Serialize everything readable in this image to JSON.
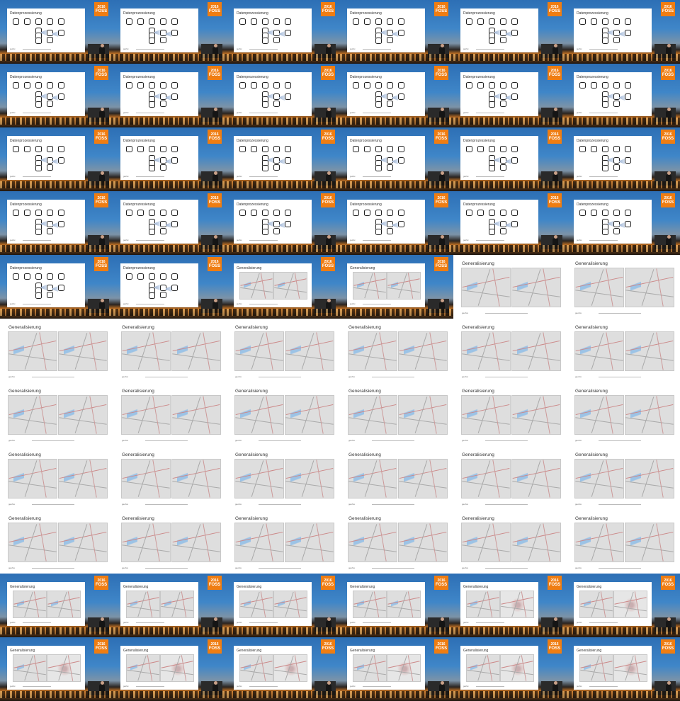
{
  "grid": {
    "columns": 6,
    "rows": 11
  },
  "logo": {
    "year": "2016",
    "name": "FOSS",
    "color": "#ef7d12"
  },
  "slide_titles": {
    "diagram": "Datenprozessierung",
    "maps": "Generalisierung"
  },
  "footer_label": "geofox",
  "cells": [
    {
      "scene": "stage",
      "content": "diagram"
    },
    {
      "scene": "stage",
      "content": "diagram"
    },
    {
      "scene": "stage",
      "content": "diagram"
    },
    {
      "scene": "stage",
      "content": "diagram"
    },
    {
      "scene": "stage",
      "content": "diagram"
    },
    {
      "scene": "stage",
      "content": "diagram"
    },
    {
      "scene": "stage",
      "content": "diagram"
    },
    {
      "scene": "stage",
      "content": "diagram"
    },
    {
      "scene": "stage",
      "content": "diagram"
    },
    {
      "scene": "stage",
      "content": "diagram"
    },
    {
      "scene": "stage",
      "content": "diagram"
    },
    {
      "scene": "stage",
      "content": "diagram"
    },
    {
      "scene": "stage",
      "content": "diagram"
    },
    {
      "scene": "stage",
      "content": "diagram"
    },
    {
      "scene": "stage",
      "content": "diagram"
    },
    {
      "scene": "stage",
      "content": "diagram"
    },
    {
      "scene": "stage",
      "content": "diagram"
    },
    {
      "scene": "stage",
      "content": "diagram"
    },
    {
      "scene": "stage",
      "content": "diagram"
    },
    {
      "scene": "stage",
      "content": "diagram"
    },
    {
      "scene": "stage",
      "content": "diagram"
    },
    {
      "scene": "stage",
      "content": "diagram"
    },
    {
      "scene": "stage",
      "content": "diagram"
    },
    {
      "scene": "stage",
      "content": "diagram"
    },
    {
      "scene": "stage",
      "content": "diagram"
    },
    {
      "scene": "stage",
      "content": "diagram"
    },
    {
      "scene": "stage",
      "content": "maps"
    },
    {
      "scene": "stage",
      "content": "maps"
    },
    {
      "scene": "clean",
      "content": "maps"
    },
    {
      "scene": "clean",
      "content": "maps"
    },
    {
      "scene": "clean",
      "content": "maps"
    },
    {
      "scene": "clean",
      "content": "maps"
    },
    {
      "scene": "clean",
      "content": "maps"
    },
    {
      "scene": "clean",
      "content": "maps"
    },
    {
      "scene": "clean",
      "content": "maps"
    },
    {
      "scene": "clean",
      "content": "maps"
    },
    {
      "scene": "clean",
      "content": "maps"
    },
    {
      "scene": "clean",
      "content": "maps"
    },
    {
      "scene": "clean",
      "content": "maps"
    },
    {
      "scene": "clean",
      "content": "maps"
    },
    {
      "scene": "clean",
      "content": "maps"
    },
    {
      "scene": "clean",
      "content": "maps"
    },
    {
      "scene": "clean",
      "content": "maps"
    },
    {
      "scene": "clean",
      "content": "maps"
    },
    {
      "scene": "clean",
      "content": "maps"
    },
    {
      "scene": "clean",
      "content": "maps"
    },
    {
      "scene": "clean",
      "content": "maps"
    },
    {
      "scene": "clean",
      "content": "maps"
    },
    {
      "scene": "clean",
      "content": "maps"
    },
    {
      "scene": "clean",
      "content": "maps"
    },
    {
      "scene": "clean",
      "content": "maps"
    },
    {
      "scene": "clean",
      "content": "maps"
    },
    {
      "scene": "clean",
      "content": "maps"
    },
    {
      "scene": "clean",
      "content": "maps"
    },
    {
      "scene": "stage",
      "content": "maps"
    },
    {
      "scene": "stage",
      "content": "maps"
    },
    {
      "scene": "stage",
      "content": "maps"
    },
    {
      "scene": "stage",
      "content": "maps"
    },
    {
      "scene": "stage",
      "content": "maps-detail"
    },
    {
      "scene": "stage",
      "content": "maps-detail"
    },
    {
      "scene": "stage",
      "content": "maps-detail"
    },
    {
      "scene": "stage",
      "content": "maps-detail"
    },
    {
      "scene": "stage",
      "content": "maps-detail"
    },
    {
      "scene": "stage",
      "content": "maps-detail"
    },
    {
      "scene": "stage",
      "content": "maps-detail"
    },
    {
      "scene": "stage",
      "content": "maps-detail"
    }
  ]
}
